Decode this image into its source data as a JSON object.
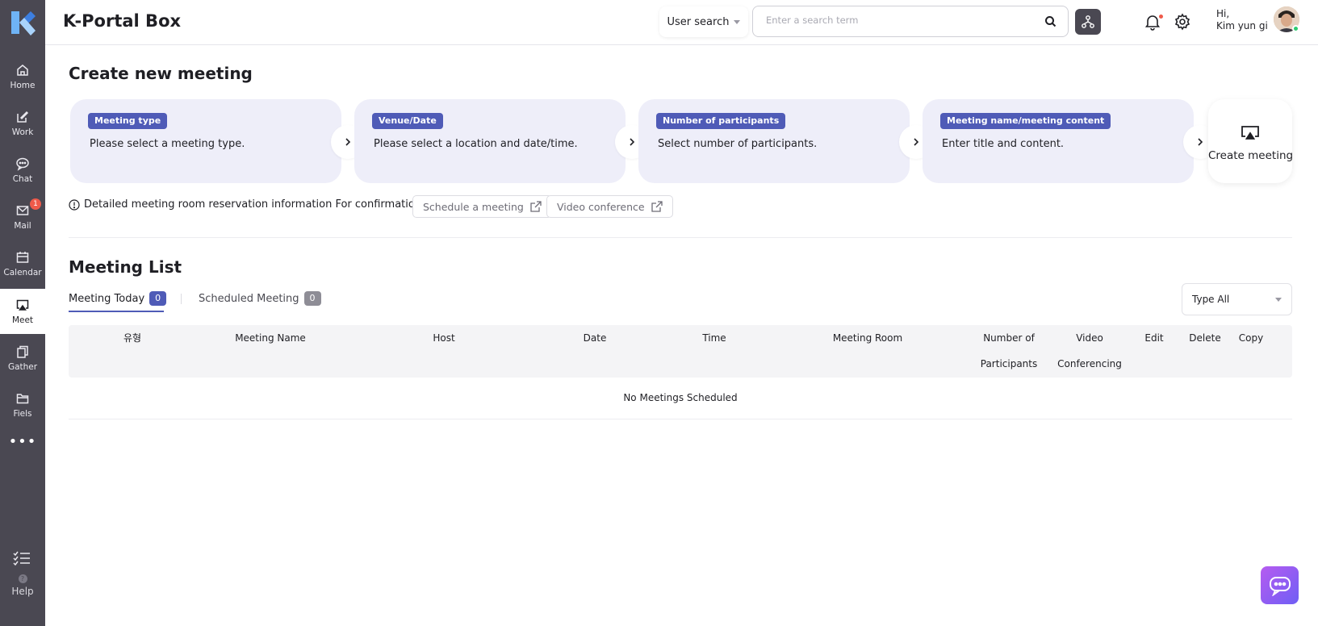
{
  "sidebar": {
    "items": [
      {
        "label": "Home",
        "icon": "home-icon"
      },
      {
        "label": "Work",
        "icon": "edit-icon"
      },
      {
        "label": "Chat",
        "icon": "chat-icon"
      },
      {
        "label": "Mail",
        "icon": "mail-icon",
        "badge": "1"
      },
      {
        "label": "Calendar",
        "icon": "calendar-icon"
      },
      {
        "label": "Meet",
        "icon": "screen-share-icon"
      },
      {
        "label": "Gather",
        "icon": "copy-icon"
      },
      {
        "label": "Fiels",
        "icon": "folder-icon"
      }
    ],
    "help_label": "Help",
    "help_glyph": "?"
  },
  "header": {
    "app_title": "K-Portal Box",
    "search_type_label": "User search",
    "search_placeholder": "Enter a search term",
    "greeting_line1": "Hi,",
    "greeting_line2": "Kim yun gi"
  },
  "create": {
    "title": "Create new meeting",
    "steps": [
      {
        "tag": "Meeting type",
        "text": "Please select a meeting type."
      },
      {
        "tag": "Venue/Date",
        "text": "Please select a location and date/time."
      },
      {
        "tag": "Number of participants",
        "text": "Select number of participants."
      },
      {
        "tag": "Meeting name/meeting content",
        "text": "Enter title and content."
      }
    ],
    "create_button_label": "Create meeting",
    "info_text": "Detailed meeting room reservation information For confirmation",
    "schedule_link_label": "Schedule a meeting",
    "video_link_label": "Video conference"
  },
  "list": {
    "title": "Meeting List",
    "tabs": [
      {
        "label": "Meeting Today",
        "count": "0",
        "active": true
      },
      {
        "label": "Scheduled Meeting",
        "count": "0",
        "active": false
      }
    ],
    "type_filter": "Type All",
    "columns": [
      "유형",
      "Meeting Name",
      "Host",
      "Date",
      "Time",
      "Meeting Room",
      "Number of Participants",
      "Video Conferencing",
      "Edit",
      "Delete",
      "Copy"
    ],
    "columns_wrapped": {
      "participants_line1": "Number of",
      "participants_line2": "Participants",
      "video_line1": "Video",
      "video_line2": "Conferencing"
    },
    "empty_text": "No Meetings Scheduled"
  },
  "colors": {
    "sidebar_bg": "#4a4852",
    "accent": "#4f5bb7",
    "card_bg": "#eeeef9",
    "badge_red": "#ef5a4a",
    "tab_count_inactive": "#8e8d96"
  }
}
